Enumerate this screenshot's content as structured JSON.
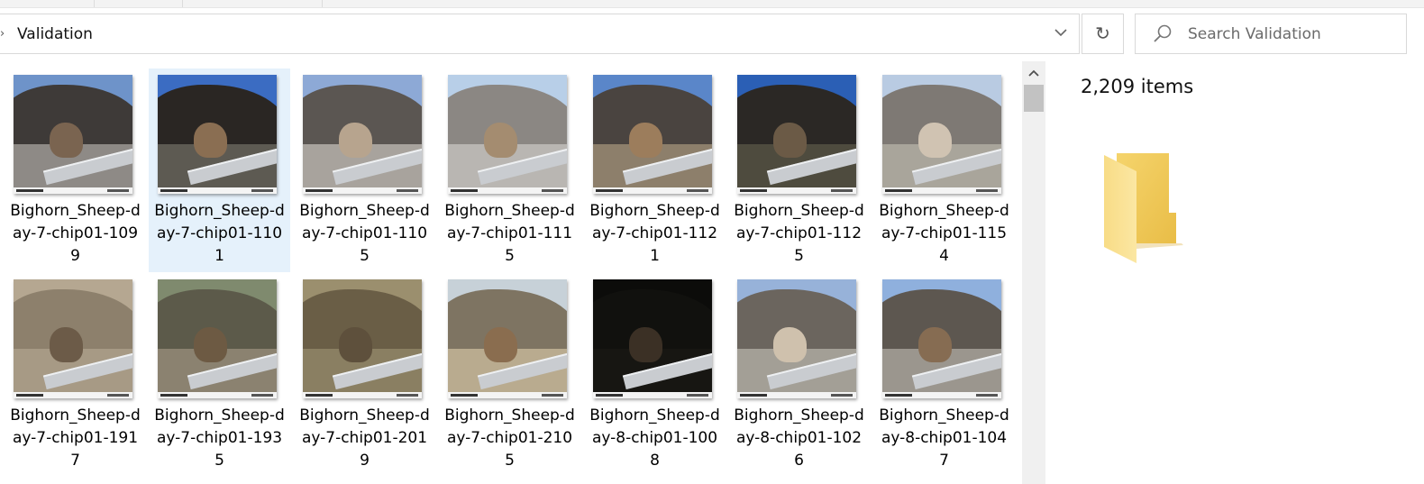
{
  "address": {
    "path": "Validation"
  },
  "search": {
    "placeholder": "Search Validation"
  },
  "preview": {
    "item_count": "2,209 items"
  },
  "colors": {
    "selected_bg": "#e5f1fb",
    "folder": "#f8d775",
    "border": "#d9d9d9"
  },
  "icons": {
    "address_chevron": "chevron-right-icon",
    "address_dropdown": "chevron-down-icon",
    "refresh": "refresh-icon",
    "search": "search-icon",
    "scroll_up": "chevron-up-icon",
    "preview_folder": "folder-icon"
  },
  "files": [
    {
      "name": "Bighorn_Sheep-day-7-chip01-1099",
      "selected": false
    },
    {
      "name": "Bighorn_Sheep-day-7-chip01-1101",
      "selected": true
    },
    {
      "name": "Bighorn_Sheep-day-7-chip01-1105",
      "selected": false
    },
    {
      "name": "Bighorn_Sheep-day-7-chip01-1115",
      "selected": false
    },
    {
      "name": "Bighorn_Sheep-day-7-chip01-1121",
      "selected": false
    },
    {
      "name": "Bighorn_Sheep-day-7-chip01-1125",
      "selected": false
    },
    {
      "name": "Bighorn_Sheep-day-7-chip01-1154",
      "selected": false
    },
    {
      "name": "Bighorn_Sheep-day-7-chip01-1917",
      "selected": false
    },
    {
      "name": "Bighorn_Sheep-day-7-chip01-1935",
      "selected": false
    },
    {
      "name": "Bighorn_Sheep-day-7-chip01-2019",
      "selected": false
    },
    {
      "name": "Bighorn_Sheep-day-7-chip01-2105",
      "selected": false
    },
    {
      "name": "Bighorn_Sheep-day-8-chip01-1008",
      "selected": false
    },
    {
      "name": "Bighorn_Sheep-day-8-chip01-1026",
      "selected": false
    },
    {
      "name": "Bighorn_Sheep-day-8-chip01-1047",
      "selected": false
    }
  ]
}
